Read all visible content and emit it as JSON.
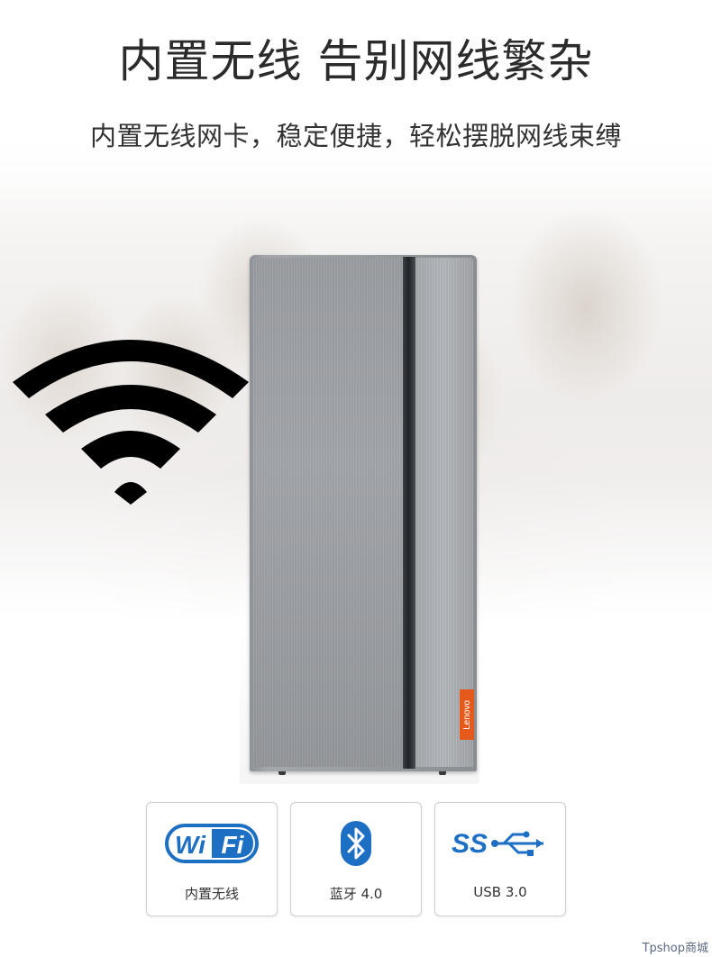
{
  "header": {
    "title": "内置无线 告别网线繁杂",
    "subtitle": "内置无线网卡，稳定便捷，轻松摆脱网线束缚"
  },
  "product": {
    "brand_label": "Lenovo",
    "accent_color": "#e55a1c"
  },
  "features": [
    {
      "icon": "wifi-logo-icon",
      "logo_text": "Wi Fi",
      "label": "内置无线"
    },
    {
      "icon": "bluetooth-icon",
      "label": "蓝牙 4.0"
    },
    {
      "icon": "usb-superspeed-icon",
      "logo_text": "SS",
      "label": "USB 3.0"
    }
  ],
  "watermark": "Tpshop商城",
  "colors": {
    "wifi_blue": "#1d6fc4",
    "wifi_symbol": "#000000"
  }
}
